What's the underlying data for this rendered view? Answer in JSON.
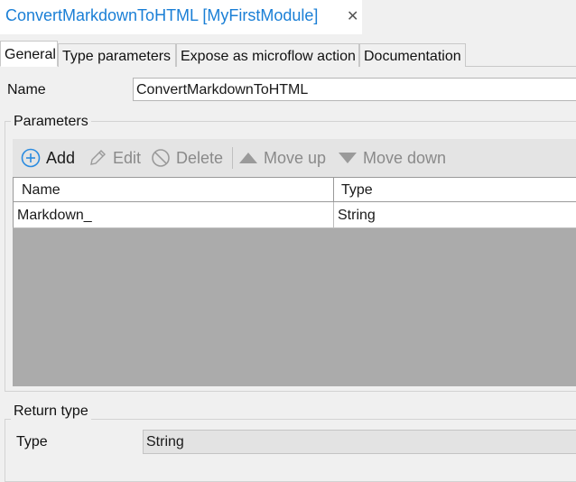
{
  "document_tab": {
    "title": "ConvertMarkdownToHTML [MyFirstModule]",
    "close_glyph": "✕"
  },
  "tabs": [
    {
      "label": "General",
      "active": true
    },
    {
      "label": "Type parameters",
      "active": false
    },
    {
      "label": "Expose as microflow action",
      "active": false
    },
    {
      "label": "Documentation",
      "active": false
    }
  ],
  "general": {
    "name_label": "Name",
    "name_value": "ConvertMarkdownToHTML"
  },
  "parameters": {
    "group_title": "Parameters",
    "toolbar": {
      "add": {
        "label": "Add",
        "icon": "plus-circle-icon",
        "enabled": true
      },
      "edit": {
        "label": "Edit",
        "icon": "pencil-icon",
        "enabled": false
      },
      "delete": {
        "label": "Delete",
        "icon": "no-entry-icon",
        "enabled": false
      },
      "move_up": {
        "label": "Move up",
        "icon": "triangle-up-icon",
        "enabled": false
      },
      "move_down": {
        "label": "Move down",
        "icon": "triangle-down-icon",
        "enabled": false
      }
    },
    "columns": [
      "Name",
      "Type"
    ],
    "rows": [
      {
        "name": "Markdown_",
        "type": "String"
      }
    ]
  },
  "return_type": {
    "group_title": "Return type",
    "type_label": "Type",
    "type_value": "String"
  },
  "colors": {
    "accent": "#1a7fd6",
    "disabled_text": "#8a8a8a",
    "grid_empty": "#ababab"
  }
}
